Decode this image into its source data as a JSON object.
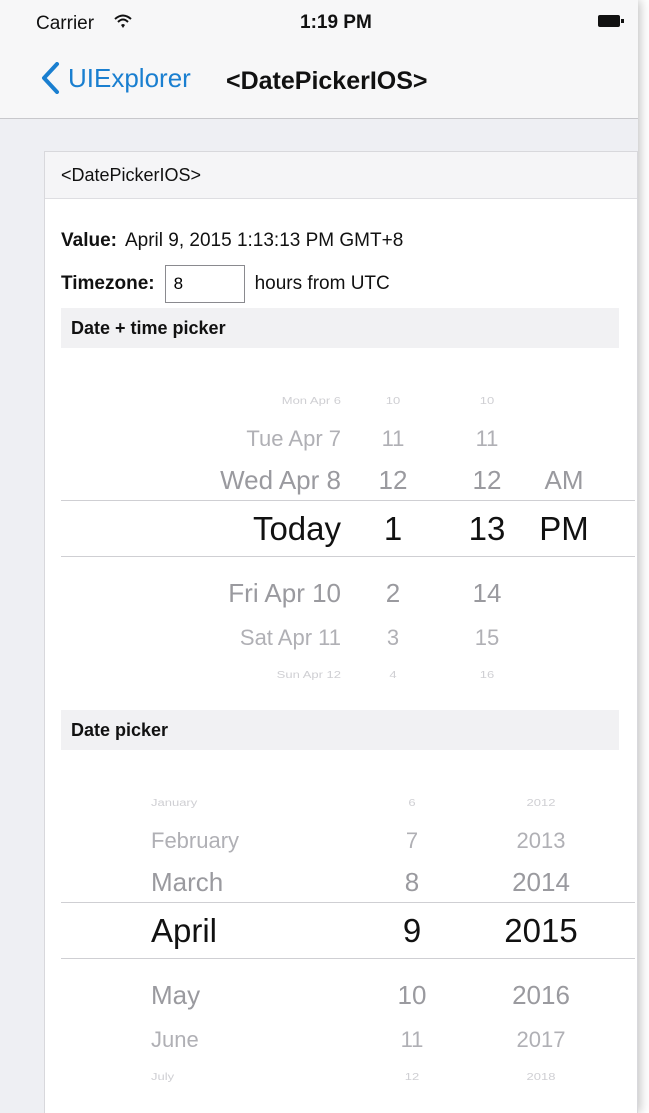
{
  "status_bar": {
    "carrier": "Carrier",
    "time": "1:19 PM",
    "wifi_icon": "wifi-icon",
    "battery_icon": "battery-icon"
  },
  "nav_bar": {
    "back_label": "UIExplorer",
    "back_icon": "chevron-left-icon",
    "title": "<DatePickerIOS>"
  },
  "card": {
    "title": "<DatePickerIOS>",
    "value_label": "Value:",
    "value_text": "April 9, 2015 1:13:13 PM GMT+8",
    "timezone_label": "Timezone:",
    "timezone_value": "8",
    "timezone_suffix": "hours from UTC"
  },
  "datetime_picker": {
    "section_title": "Date + time picker",
    "columns": {
      "date": [
        "Mon Apr 6",
        "Tue Apr 7",
        "Wed Apr 8",
        "Today",
        "Fri Apr 10",
        "Sat Apr 11",
        "Sun Apr 12"
      ],
      "hour": [
        "10",
        "11",
        "12",
        "1",
        "2",
        "3",
        "4"
      ],
      "minute": [
        "10",
        "11",
        "12",
        "13",
        "14",
        "15",
        "16"
      ],
      "ampm": [
        "AM",
        "PM"
      ]
    },
    "selected": {
      "date": "Today",
      "hour": "1",
      "minute": "13",
      "ampm": "PM"
    }
  },
  "date_picker": {
    "section_title": "Date picker",
    "columns": {
      "month": [
        "January",
        "February",
        "March",
        "April",
        "May",
        "June",
        "July"
      ],
      "day": [
        "6",
        "7",
        "8",
        "9",
        "10",
        "11",
        "12"
      ],
      "year": [
        "2012",
        "2013",
        "2014",
        "2015",
        "2016",
        "2017",
        "2018"
      ]
    },
    "selected": {
      "month": "April",
      "day": "9",
      "year": "2015"
    }
  },
  "colors": {
    "accent": "#1a7fd0",
    "background": "#eeeff3",
    "selection_line": "#cfcfd3"
  }
}
